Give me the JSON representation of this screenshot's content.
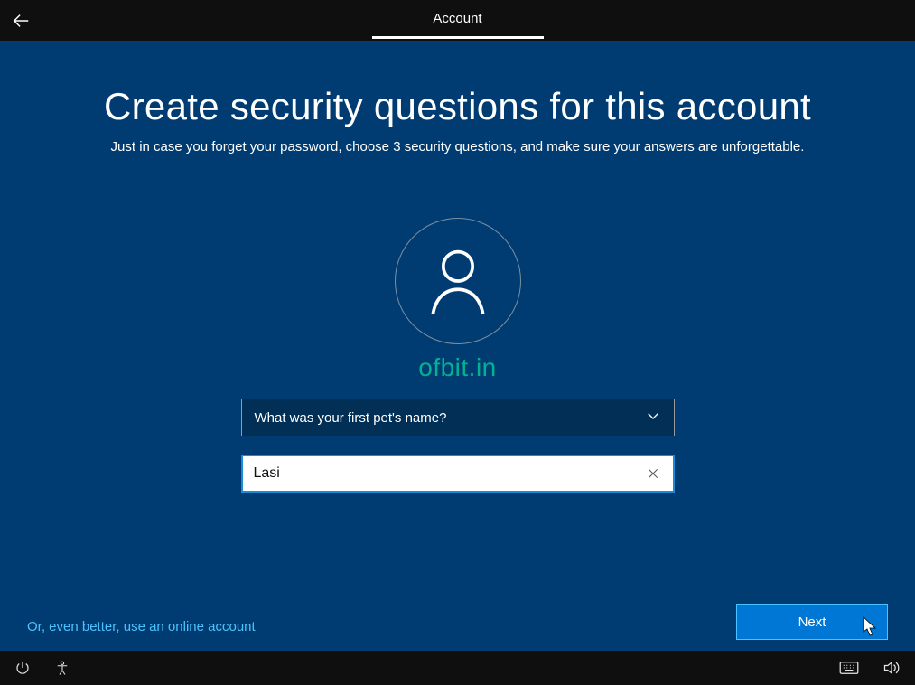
{
  "header": {
    "tab_label": "Account"
  },
  "page": {
    "title": "Create security questions for this account",
    "subtitle": "Just in case you forget your password, choose 3 security questions, and make sure your answers are unforgettable."
  },
  "watermark": "ofbit.in",
  "form": {
    "question_selected": "What was your first pet's name?",
    "answer_value": "Lasi"
  },
  "footer": {
    "link_text": "Or, even better, use an online account",
    "next_label": "Next"
  }
}
